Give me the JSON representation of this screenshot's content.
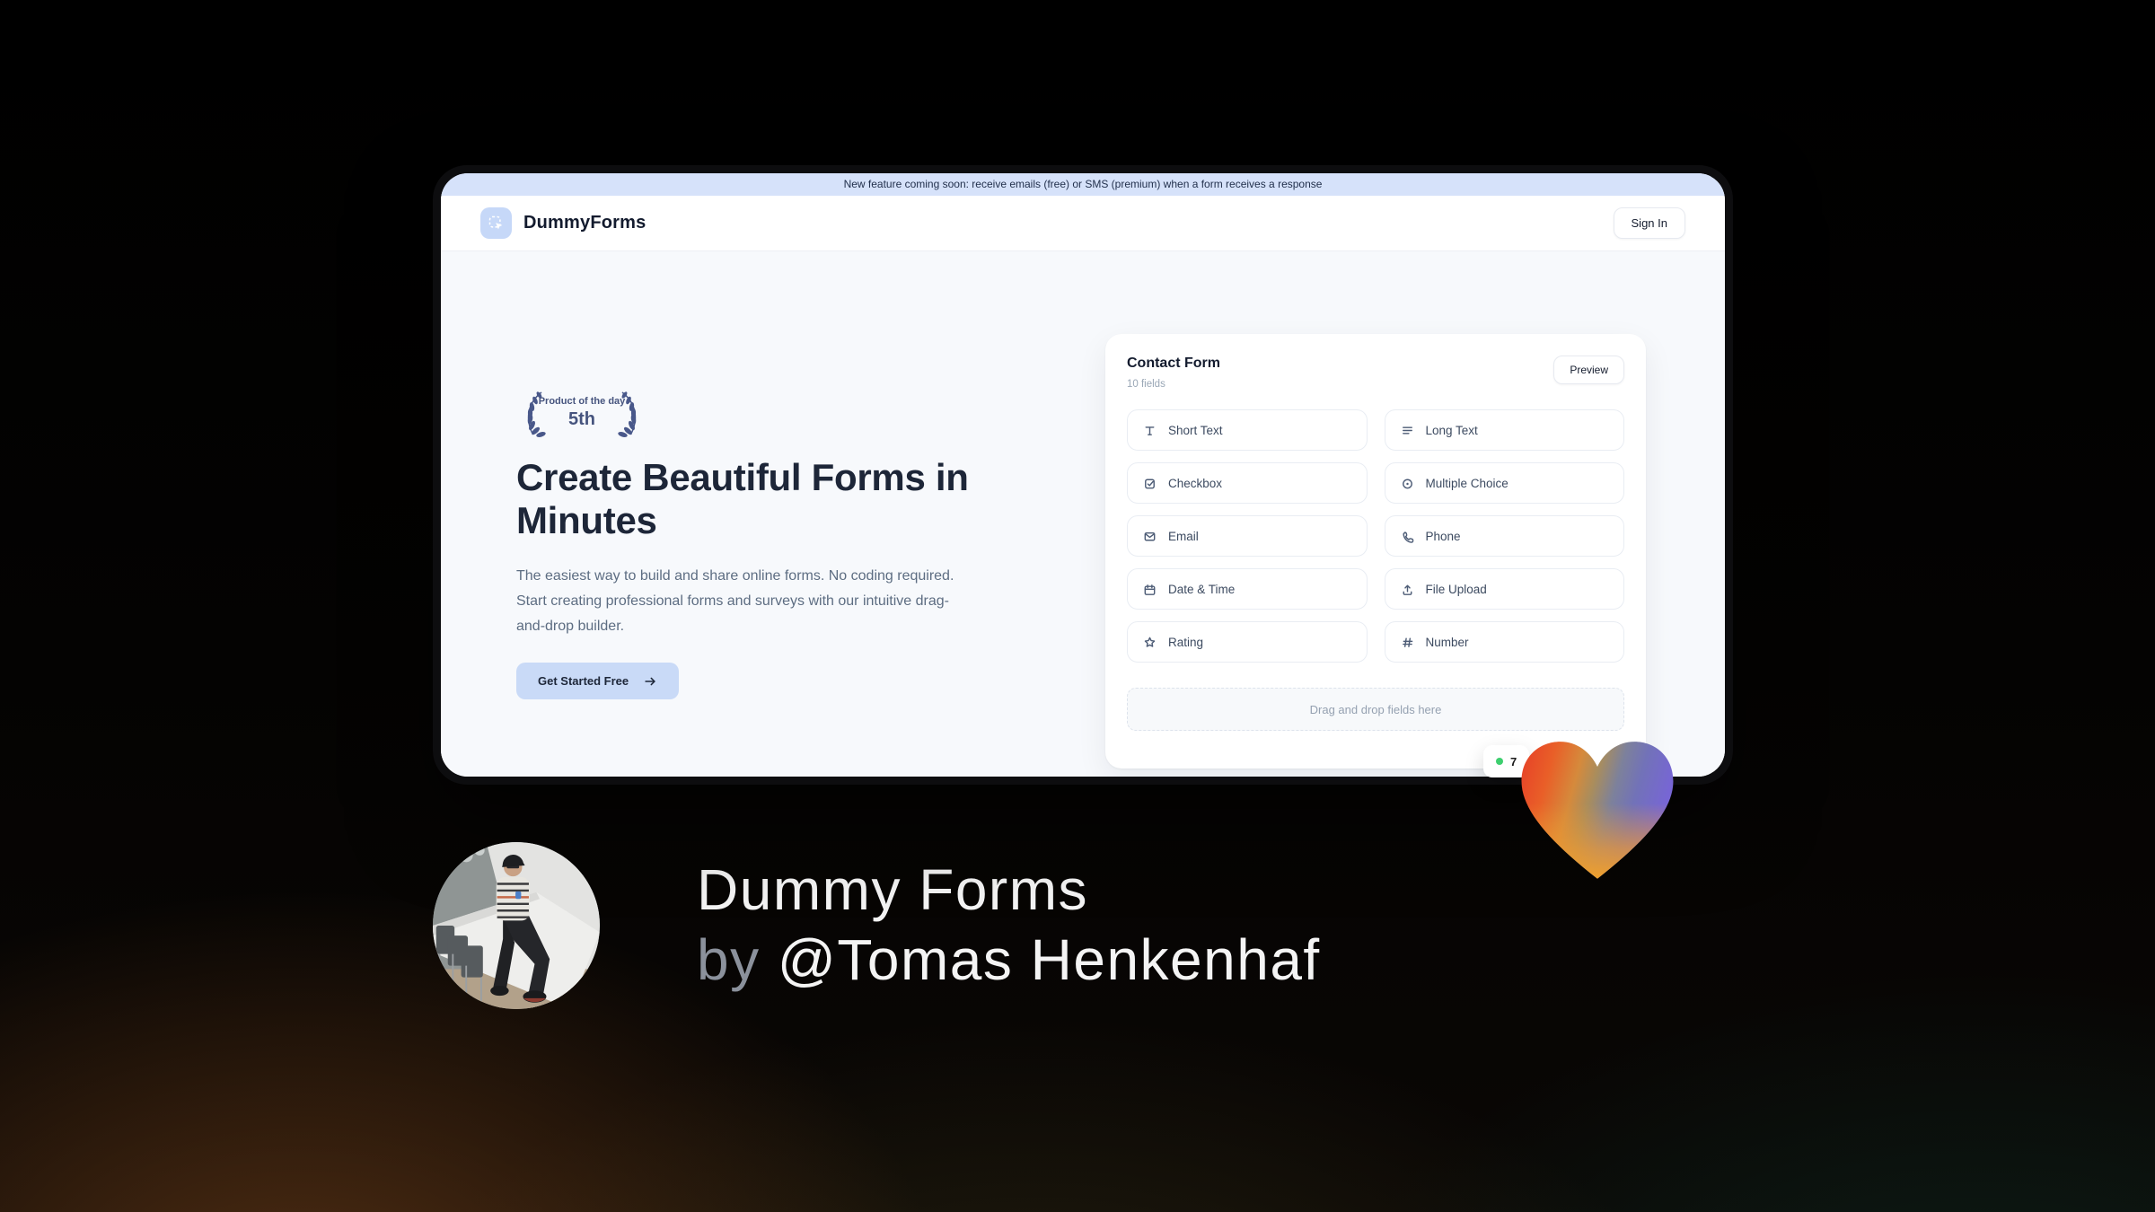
{
  "banner": {
    "text": "New feature coming soon: receive emails (free) or SMS (premium) when a form receives a response"
  },
  "header": {
    "brand": "DummyForms",
    "sign_in_label": "Sign In"
  },
  "hero": {
    "badge": {
      "top": "Product of the day",
      "rank": "5th"
    },
    "title": "Create Beautiful Forms in Minutes",
    "description": "The easiest way to build and share online forms. No coding required. Start creating professional forms and surveys with our intuitive drag-and-drop builder.",
    "cta_label": "Get Started Free"
  },
  "builder": {
    "title": "Contact Form",
    "subtitle": "10 fields",
    "preview_label": "Preview",
    "fields": [
      {
        "label": "Short Text",
        "icon": "short-text-icon"
      },
      {
        "label": "Long Text",
        "icon": "long-text-icon"
      },
      {
        "label": "Checkbox",
        "icon": "checkbox-icon"
      },
      {
        "label": "Multiple Choice",
        "icon": "multiple-choice-icon"
      },
      {
        "label": "Email",
        "icon": "email-icon"
      },
      {
        "label": "Phone",
        "icon": "phone-icon"
      },
      {
        "label": "Date & Time",
        "icon": "calendar-icon"
      },
      {
        "label": "File Upload",
        "icon": "upload-icon"
      },
      {
        "label": "Rating",
        "icon": "star-icon"
      },
      {
        "label": "Number",
        "icon": "hash-icon"
      }
    ],
    "dropzone_text": "Drag and drop fields here"
  },
  "live_badge": {
    "count": "7"
  },
  "credit": {
    "line1": "Dummy Forms",
    "by": "by",
    "author": "@Tomas Henkenhaf"
  },
  "colors": {
    "banner_bg": "#d6e2fa",
    "accent_blue": "#c9daf7",
    "frame_dark": "#0d0d0f",
    "laurel": "#49588a",
    "live_dot_green": "#3ecf6f",
    "heart_red": "#e63e28",
    "heart_orange": "#f09a2f",
    "heart_blue": "#6f7fa5",
    "heart_purple": "#7766d4"
  }
}
